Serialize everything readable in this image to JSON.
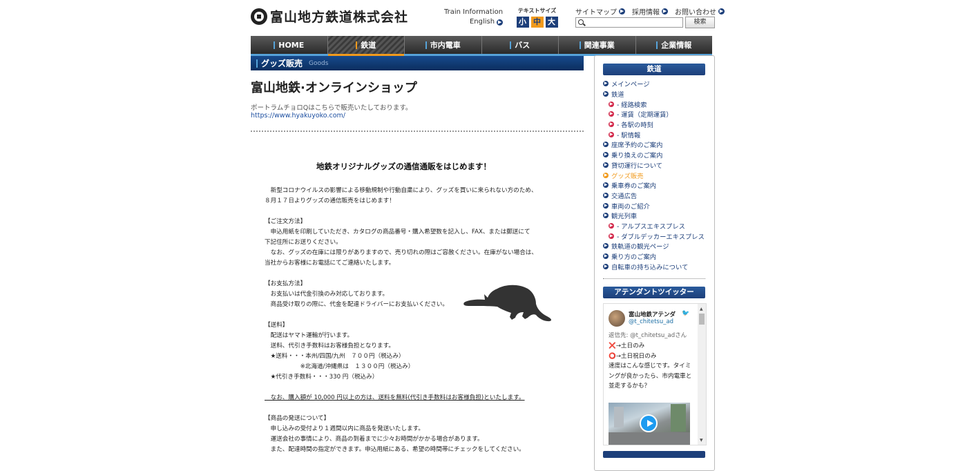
{
  "header": {
    "logo_text": "富山地方鉄道株式会社",
    "train_info": "Train Information",
    "english": "English",
    "text_size_label": "テキストサイズ",
    "text_sizes": [
      "小",
      "中",
      "大"
    ],
    "links": [
      "サイトマップ",
      "採用情報",
      "お問い合わせ"
    ],
    "search_placeholder": "",
    "search_button": "検索"
  },
  "nav": [
    "HOME",
    "鉄道",
    "市内電車",
    "バス",
    "関連事業",
    "企業情報"
  ],
  "main": {
    "section_title": "グッズ販売",
    "section_en": "Goods",
    "page_title": "富山地鉄·オンラインショップ",
    "intro": "ポートラムチョロQはこちらで販売いたしております。",
    "intro_link": "https://www.hyakuyoko.com/",
    "doc_heading": "地鉄オリジナルグッズの通信通販をはじめます！",
    "doc_lines": [
      "　新型コロナウイルスの影響による移動規制や行動自粛により、グッズを買いに来られない方のため、",
      "８月１７日よりグッズの通信販売をはじめます！",
      "",
      "【ご注文方法】",
      "　申込用紙を印刷していただき、カタログの商品番号・購入希望数を記入し、FAX、または郵送にて",
      "下記住所にお送りください。",
      "　なお、グッズの在庫には限りがありますので、売り切れの際はご容赦ください。在庫がない場合は、",
      "当社からお客様にお電話にてご連絡いたします。",
      "",
      "【お支払方法】",
      "　お支払いは代金引換のみ対応しております。",
      "　商品受け取りの際に、代金を配達ドライバーにお支払いください。",
      "",
      "【送料】",
      "　配送はヤマト運輸が行います。",
      "　送料、代引き手数料はお客様負担となります。",
      "　★送料・・・本州/四国/九州　７００円（税込み）",
      "　　　　　　※北海道/沖縄県は　１３００円（税込み）",
      "　★代引き手数料・・・330 円（税込み）",
      "",
      "　なお、購入額が 10,000 円以上の方は、送料を無料(代引き手数料はお客様負担)といたします。",
      "",
      "【商品の発送について】",
      "　申し込みの受付より１週間以内に商品を発送いたします。",
      "　運送会社の事情により、商品の到着までに少々お時間がかかる場合があります。",
      "　また、配達時間の指定ができます。申込用紙にある、希望の時間帯にチェックをしてください。"
    ]
  },
  "sidebar": {
    "title": "鉄道",
    "items": [
      {
        "label": "メインページ",
        "level": 0
      },
      {
        "label": "鉄道",
        "level": 0
      },
      {
        "label": "- 経路検索",
        "level": 1
      },
      {
        "label": "- 運賃（定期運賃）",
        "level": 1
      },
      {
        "label": "- 各駅の時刻",
        "level": 1
      },
      {
        "label": "- 駅情報",
        "level": 1
      },
      {
        "label": "座席予約のご案内",
        "level": 0
      },
      {
        "label": "乗り換えのご案内",
        "level": 0
      },
      {
        "label": "貸切運行について",
        "level": 0
      },
      {
        "label": "グッズ販売",
        "level": 0,
        "current": true
      },
      {
        "label": "乗車券のご案内",
        "level": 0
      },
      {
        "label": "交通広告",
        "level": 0
      },
      {
        "label": "車両のご紹介",
        "level": 0
      },
      {
        "label": "観光列車",
        "level": 0
      },
      {
        "label": "- アルプスエキスプレス",
        "level": 1
      },
      {
        "label": "- ダブルデッカーエキスプレス",
        "level": 1
      },
      {
        "label": "鉄軌道の観光ページ",
        "level": 0
      },
      {
        "label": "乗り方のご案内",
        "level": 0
      },
      {
        "label": "自転車の持ち込みについて",
        "level": 0
      }
    ],
    "twitter_title": "アテンダントツイッター",
    "tweet": {
      "name": "富山地鉄アテンダ",
      "handle": "@t_chitetsu_ad",
      "reply_to": "返信先: @t_chitetsu_adさん",
      "line1_mark": "❌",
      "line1": "→土日のみ",
      "line2_mark": "⭕",
      "line2": "→土日祝日のみ",
      "line3": "速度はこんな感じです。タイミングが良かったら、市内電車と並走するかも？"
    }
  },
  "colors": {
    "navy": "#1d3f7a",
    "accent_orange": "#f19a1c",
    "nav_blue": "#56a3d9",
    "sub_red": "#d22a4c"
  }
}
